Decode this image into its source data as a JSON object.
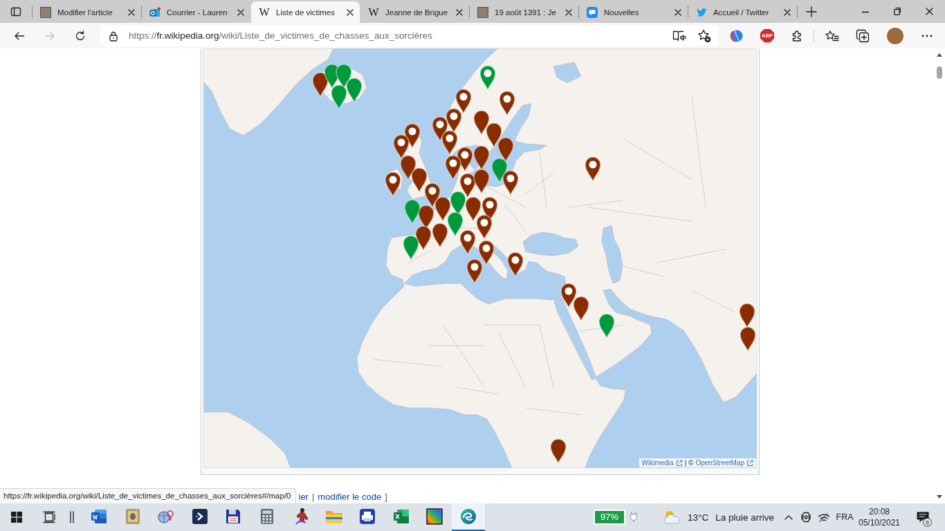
{
  "browser": {
    "tabs": [
      {
        "title": "Modifier l'article",
        "kind": "photo",
        "selected": false
      },
      {
        "title": "Courrier - Lauren",
        "kind": "mail",
        "selected": false
      },
      {
        "title": "Liste de victimes",
        "kind": "wiki",
        "favicon_text": "W",
        "selected": true
      },
      {
        "title": "Jeanne de Brigue",
        "kind": "wiki",
        "favicon_text": "W",
        "selected": false
      },
      {
        "title": "19 août 1391 : Je",
        "kind": "photo",
        "selected": false
      },
      {
        "title": "Nouvelles",
        "kind": "tile",
        "selected": false
      },
      {
        "title": "Accueil / Twitter",
        "kind": "bird",
        "selected": false
      }
    ],
    "nav": {
      "back_disabled": false,
      "forward_disabled": true
    },
    "address": {
      "scheme": "https://",
      "host": "fr.wikipedia.org",
      "path": "/wiki/Liste_de_victimes_de_chasses_aux_sorcières"
    },
    "extensions": {
      "badge_text": "ABP"
    }
  },
  "map": {
    "markers": [
      {
        "color": "#8a2c00",
        "kind": "plain"
      },
      {
        "color": "#009a3e",
        "kind": "plain"
      },
      {
        "color": "#009a3e",
        "kind": "plain"
      },
      {
        "color": "#009a3e",
        "kind": "plain"
      },
      {
        "color": "#009a3e",
        "kind": "plain"
      },
      {
        "color": "#009a3e",
        "kind": "dot"
      },
      {
        "color": "#8a2c00",
        "kind": "dot"
      },
      {
        "color": "#8a2c00",
        "kind": "dot"
      },
      {
        "color": "#8a2c00",
        "kind": "dot"
      },
      {
        "color": "#8a2c00",
        "kind": "dot"
      },
      {
        "color": "#8a2c00",
        "kind": "plain"
      },
      {
        "color": "#8a2c00",
        "kind": "plain"
      },
      {
        "color": "#8a2c00",
        "kind": "plain"
      },
      {
        "color": "#8a2c00",
        "kind": "dot"
      },
      {
        "color": "#8a2c00",
        "kind": "dot"
      },
      {
        "color": "#8a2c00",
        "kind": "dot"
      },
      {
        "color": "#8a2c00",
        "kind": "dot"
      },
      {
        "color": "#8a2c00",
        "kind": "dot"
      },
      {
        "color": "#8a2c00",
        "kind": "plain"
      },
      {
        "color": "#8a2c00",
        "kind": "plain"
      },
      {
        "color": "#8a2c00",
        "kind": "plain"
      },
      {
        "color": "#8a2c00",
        "kind": "dot"
      },
      {
        "color": "#009a3e",
        "kind": "plain"
      },
      {
        "color": "#8a2c00",
        "kind": "dot"
      },
      {
        "color": "#8a2c00",
        "kind": "dot"
      },
      {
        "color": "#8a2c00",
        "kind": "dot"
      },
      {
        "color": "#8a2c00",
        "kind": "dot"
      },
      {
        "color": "#8a2c00",
        "kind": "plain"
      },
      {
        "color": "#009a3e",
        "kind": "plain"
      },
      {
        "color": "#8a2c00",
        "kind": "plain"
      },
      {
        "color": "#8a2c00",
        "kind": "plain"
      },
      {
        "color": "#009a3e",
        "kind": "plain"
      },
      {
        "color": "#8a2c00",
        "kind": "dot"
      },
      {
        "color": "#8a2c00",
        "kind": "plain"
      },
      {
        "color": "#8a2c00",
        "kind": "dot"
      },
      {
        "color": "#009a3e",
        "kind": "plain"
      },
      {
        "color": "#8a2c00",
        "kind": "plain"
      },
      {
        "color": "#8a2c00",
        "kind": "plain"
      },
      {
        "color": "#8a2c00",
        "kind": "dot"
      },
      {
        "color": "#8a2c00",
        "kind": "dot"
      },
      {
        "color": "#009a3e",
        "kind": "plain"
      },
      {
        "color": "#8a2c00",
        "kind": "dot"
      },
      {
        "color": "#8a2c00",
        "kind": "dot"
      },
      {
        "color": "#8a2c00",
        "kind": "dot"
      },
      {
        "color": "#8a2c00",
        "kind": "plain"
      },
      {
        "color": "#009a3e",
        "kind": "plain"
      },
      {
        "color": "#8a2c00",
        "kind": "plain"
      },
      {
        "color": "#8a2c00",
        "kind": "plain"
      },
      {
        "color": "#8a2c00",
        "kind": "plain"
      }
    ],
    "attribution": {
      "links": [
        "Wikimedia",
        "OpenStreetMap"
      ],
      "separator": "| ©"
    }
  },
  "status_tooltip": "https://fr.wikipedia.org/wiki/Liste_de_victimes_de_chasses_aux_sorcières#/map/0",
  "section_edit": {
    "links": [
      "ier",
      "modifier le code"
    ],
    "separator": "|",
    "bracket": "]"
  },
  "taskbar": {
    "apps": [
      {
        "running": false
      },
      {
        "running": false
      },
      {
        "running": false
      },
      {
        "running": false
      },
      {
        "running": false
      },
      {
        "running": false
      },
      {
        "running": false
      },
      {
        "running": false
      },
      {
        "running": false
      },
      {
        "running": false
      },
      {
        "running": false
      },
      {
        "running": true
      }
    ],
    "battery": "97%",
    "weather": {
      "temperature": "13°C",
      "forecast": "La pluie arrive"
    },
    "language": "FRA",
    "time": "20:08",
    "date": "05/10/2021",
    "notifications": "8"
  }
}
